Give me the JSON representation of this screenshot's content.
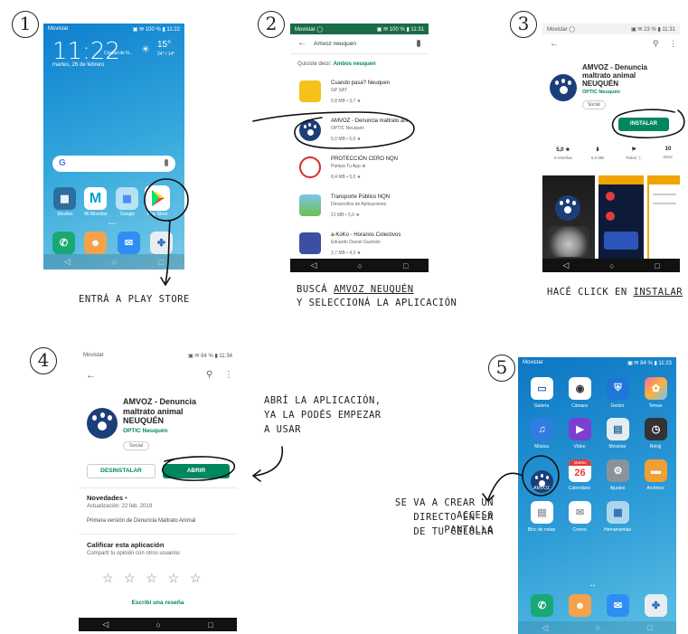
{
  "steps": [
    "1",
    "2",
    "3",
    "4",
    "5"
  ],
  "captions": {
    "s1": "ENTRÁ A PLAY STORE",
    "s2_line1_pre": "BUSCÁ ",
    "s2_line1_u": "AMVOZ NEUQUÉN",
    "s2_line2": "Y SELECCIONÁ LA APLICACIÓN",
    "s3_pre": "HACÉ CLICK EN ",
    "s3_u": "INSTALAR",
    "s4_line1": "ABRÍ LA APLICACIÓN,",
    "s4_line2": "YA LA PODÉS EMPEZAR",
    "s4_line3": "A USAR",
    "s5_line1": "SE VA A CREAR UN ACCESO",
    "s5_line2": "DIRECTO EN LA PANTALLA",
    "s5_line3": "DE TU CELULAR"
  },
  "phone1": {
    "carrier": "Movistar",
    "status_right": "▣ ✉ 100 % ▮ 11:22",
    "time": "11:22",
    "city": "Ciudad de N...",
    "temp": "15°",
    "temp_range": "24° / 14°",
    "date": "martes, 26 de febrero",
    "search_g": "G",
    "apps": [
      "Moviles",
      "Mi Movistar",
      "Google",
      "Play Store"
    ],
    "nav": [
      "◁",
      "○",
      "□"
    ]
  },
  "phone2": {
    "carrier": "Movistar ◯",
    "status_right": "▣ ✉ 100 % ▮ 11:31",
    "query": "Amvoz neuquen",
    "suggestion_pre": "Quisiste decir: ",
    "suggestion": "Ambos neuquen",
    "results": [
      {
        "title": "Cuando pasa? Neuquen",
        "dev": "GP SAT",
        "meta": "5,8 MB • 3,7 ★"
      },
      {
        "title": "AMVOZ - Denuncia maltrato ani",
        "dev": "OPTIC Neuquén",
        "meta": "5,0 MB • 5,0 ★"
      },
      {
        "title": "PROTECCIÓN CERO NQN",
        "dev": "Pampa Tu App ⊕",
        "meta": "8,4 MB • 5,0 ★"
      },
      {
        "title": "Transporte Público NQN",
        "dev": "Desarrollos de Aplicaciones",
        "meta": "21 MB • 5,0 ★"
      },
      {
        "title": "a-KoKo - Horarios Colectivos",
        "dev": "Eduardo Daniel Guzmán",
        "meta": "3,7 MB • 4,3 ★"
      }
    ],
    "nav": [
      "◁",
      "○",
      "□"
    ]
  },
  "phone3": {
    "carrier": "Movistar ◯",
    "status_right": "▣ ✉ 23 % ▮ 11:31",
    "title_l1": "AMVOZ - Denuncia",
    "title_l2": "maltrato animal",
    "title_l3": "NEUQUÉN",
    "dev": "OPTIC Neuquén",
    "tag": "Social",
    "install": "INSTALAR",
    "stats": [
      {
        "value": "5,0 ★",
        "label": "8 reseñas"
      },
      {
        "value": "⬇",
        "label": "5,0 MB"
      },
      {
        "value": "⚑",
        "label": "Todos ⓘ"
      },
      {
        "value": "10",
        "label": "Desc"
      }
    ],
    "nav": [
      "◁",
      "○",
      "□"
    ]
  },
  "phone4": {
    "carrier": "Movistar",
    "status_right": "▣ ✉ 84 % ▮ 11:34",
    "title_l1": "AMVOZ - Denuncia",
    "title_l2": "maltrato animal",
    "title_l3": "NEUQUÉN",
    "dev": "OPTIC Neuquén",
    "tag": "Social",
    "uninstall": "DESINSTALAR",
    "open": "ABRIR",
    "news_title": "Novedades",
    "news_date": "Actualización: 22 feb. 2019",
    "news_body": "Primera versión de Denuncia Maltrato Animal",
    "rate_title": "Calificar esta aplicación",
    "rate_sub": "Compartí tu opinión con otros usuarios",
    "stars": "☆   ☆   ☆   ☆   ☆",
    "review": "Escribí una reseña",
    "nav": [
      "◁",
      "○",
      "□"
    ]
  },
  "phone5": {
    "carrier": "Movistar",
    "status_right": "▣ ✉ 84 % ▮ 11:23",
    "apps_row1": [
      "Galería",
      "Cámara",
      "Gestor",
      "Temas"
    ],
    "apps_row2": [
      "Música",
      "Vídeo",
      "Movistar",
      "Relojj"
    ],
    "apps_row3": [
      "AMVOZ",
      "Calendario",
      "Ajustes",
      "Archivos"
    ],
    "apps_row4": [
      "Bloc de notas",
      "Correo",
      "Herramientas"
    ],
    "calendar_day": "26",
    "calendar_weekday": "Martes",
    "nav": [
      "◁",
      "○",
      "□"
    ]
  },
  "colors": {
    "play_green": "#01875f",
    "amvoz_blue": "#1d3f78",
    "search_bar": "#26805a"
  }
}
